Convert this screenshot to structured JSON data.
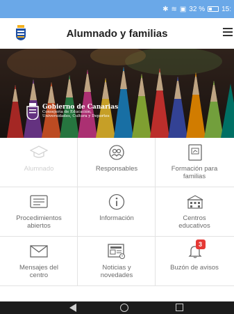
{
  "status_bar": {
    "battery_percent": "32 %",
    "time": "15:",
    "icons": [
      "bluetooth-icon",
      "wifi-icon",
      "battery-saver-icon",
      "battery-icon"
    ]
  },
  "app_bar": {
    "title": "Alumnado y familias",
    "logo_icon": "canarias-crest-icon",
    "menu_icon": "hamburger-menu-icon"
  },
  "banner": {
    "gov_name": "Gobierno de Canarias",
    "gov_line1": "Consejería de Educación,",
    "gov_line2": "Universidades, Cultura y Deportes"
  },
  "grid": {
    "items": [
      {
        "label": "Alumnado",
        "icon": "graduation-cap-icon",
        "enabled": false
      },
      {
        "label": "Responsables",
        "icon": "people-icon",
        "enabled": true
      },
      {
        "label": "Formación para\nfamilias",
        "icon": "training-board-icon",
        "enabled": true
      },
      {
        "label": "Procedimientos\nabiertos",
        "icon": "document-lines-icon",
        "enabled": true
      },
      {
        "label": "Información",
        "icon": "info-icon",
        "enabled": true
      },
      {
        "label": "Centros\neducativos",
        "icon": "school-building-icon",
        "enabled": true
      },
      {
        "label": "Mensajes del\ncentro",
        "icon": "envelope-icon",
        "enabled": true
      },
      {
        "label": "Noticias y\nnovedades",
        "icon": "news-icon",
        "enabled": true
      },
      {
        "label": "Buzón de avisos",
        "icon": "bell-icon",
        "enabled": true,
        "badge": "3"
      }
    ]
  },
  "colors": {
    "status_bar": "#6aa8e8",
    "badge": "#e53935",
    "label": "#6a6a6a",
    "label_disabled": "#cfcfcf"
  }
}
